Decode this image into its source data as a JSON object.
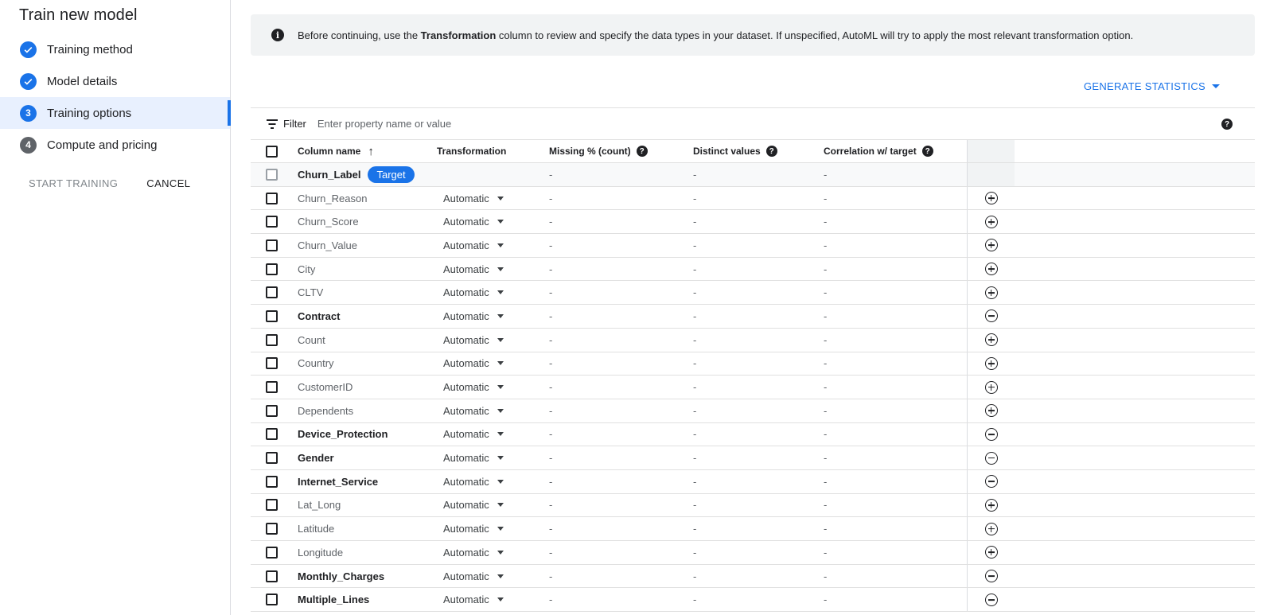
{
  "sidebar": {
    "title": "Train new model",
    "steps": [
      {
        "label": "Training method",
        "state": "done"
      },
      {
        "label": "Model details",
        "state": "done"
      },
      {
        "label": "Training options",
        "state": "active",
        "number": "3"
      },
      {
        "label": "Compute and pricing",
        "state": "pending",
        "number": "4"
      }
    ],
    "start_training": "START TRAINING",
    "cancel": "CANCEL"
  },
  "banner": {
    "text_before": "Before continuing, use the ",
    "text_bold": "Transformation",
    "text_after": " column to review and specify the data types in your dataset. If unspecified, AutoML will try to apply the most relevant transformation option."
  },
  "generate_statistics": "GENERATE STATISTICS",
  "filter": {
    "label": "Filter",
    "placeholder": "Enter property name or value"
  },
  "table": {
    "headers": {
      "column_name": "Column name",
      "transformation": "Transformation",
      "missing": "Missing % (count)",
      "distinct": "Distinct values",
      "correlation": "Correlation w/ target"
    },
    "target_row": {
      "name": "Churn_Label",
      "chip": "Target",
      "missing": "-",
      "distinct": "-",
      "correlation": "-"
    },
    "rows": [
      {
        "name": "Churn_Reason",
        "bold": false,
        "transformation": "Automatic",
        "missing": "-",
        "distinct": "-",
        "correlation": "-",
        "action": "include"
      },
      {
        "name": "Churn_Score",
        "bold": false,
        "transformation": "Automatic",
        "missing": "-",
        "distinct": "-",
        "correlation": "-",
        "action": "include"
      },
      {
        "name": "Churn_Value",
        "bold": false,
        "transformation": "Automatic",
        "missing": "-",
        "distinct": "-",
        "correlation": "-",
        "action": "include"
      },
      {
        "name": "City",
        "bold": false,
        "transformation": "Automatic",
        "missing": "-",
        "distinct": "-",
        "correlation": "-",
        "action": "include"
      },
      {
        "name": "CLTV",
        "bold": false,
        "transformation": "Automatic",
        "missing": "-",
        "distinct": "-",
        "correlation": "-",
        "action": "include"
      },
      {
        "name": "Contract",
        "bold": true,
        "transformation": "Automatic",
        "missing": "-",
        "distinct": "-",
        "correlation": "-",
        "action": "exclude"
      },
      {
        "name": "Count",
        "bold": false,
        "transformation": "Automatic",
        "missing": "-",
        "distinct": "-",
        "correlation": "-",
        "action": "include"
      },
      {
        "name": "Country",
        "bold": false,
        "transformation": "Automatic",
        "missing": "-",
        "distinct": "-",
        "correlation": "-",
        "action": "include"
      },
      {
        "name": "CustomerID",
        "bold": false,
        "transformation": "Automatic",
        "missing": "-",
        "distinct": "-",
        "correlation": "-",
        "action": "include"
      },
      {
        "name": "Dependents",
        "bold": false,
        "transformation": "Automatic",
        "missing": "-",
        "distinct": "-",
        "correlation": "-",
        "action": "include"
      },
      {
        "name": "Device_Protection",
        "bold": true,
        "transformation": "Automatic",
        "missing": "-",
        "distinct": "-",
        "correlation": "-",
        "action": "exclude"
      },
      {
        "name": "Gender",
        "bold": true,
        "transformation": "Automatic",
        "missing": "-",
        "distinct": "-",
        "correlation": "-",
        "action": "exclude"
      },
      {
        "name": "Internet_Service",
        "bold": true,
        "transformation": "Automatic",
        "missing": "-",
        "distinct": "-",
        "correlation": "-",
        "action": "exclude"
      },
      {
        "name": "Lat_Long",
        "bold": false,
        "transformation": "Automatic",
        "missing": "-",
        "distinct": "-",
        "correlation": "-",
        "action": "include"
      },
      {
        "name": "Latitude",
        "bold": false,
        "transformation": "Automatic",
        "missing": "-",
        "distinct": "-",
        "correlation": "-",
        "action": "include"
      },
      {
        "name": "Longitude",
        "bold": false,
        "transformation": "Automatic",
        "missing": "-",
        "distinct": "-",
        "correlation": "-",
        "action": "include"
      },
      {
        "name": "Monthly_Charges",
        "bold": true,
        "transformation": "Automatic",
        "missing": "-",
        "distinct": "-",
        "correlation": "-",
        "action": "exclude"
      },
      {
        "name": "Multiple_Lines",
        "bold": true,
        "transformation": "Automatic",
        "missing": "-",
        "distinct": "-",
        "correlation": "-",
        "action": "exclude"
      }
    ]
  },
  "colors": {
    "accent": "#1a73e8",
    "banner_bg": "#f1f3f4",
    "active_step_bg": "#e8f0fe"
  }
}
